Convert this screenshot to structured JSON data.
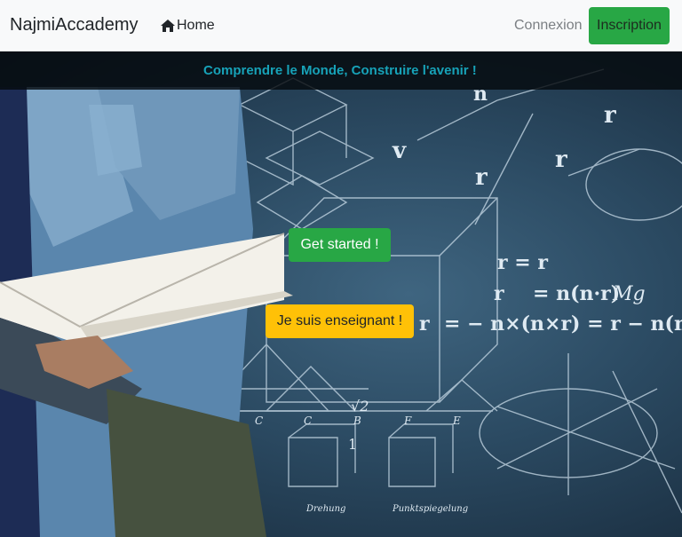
{
  "navbar": {
    "brand": "NajmiAccademy",
    "home_label": "Home",
    "login_label": "Connexion",
    "signup_label": "Inscription"
  },
  "hero": {
    "tagline": "Comprendre le Monde, Construire l'avenir !",
    "get_started_label": "Get started !",
    "teacher_label": "Je suis enseignant !",
    "board_formulas": [
      "r = r∥ + r⊥",
      "r∥ = n(n·r)",
      "r⊥ = − n×(n×r) = r − n(n·r)",
      "Mg",
      "v",
      "r",
      "r∥",
      "r⊥",
      "n",
      "√2",
      "Drehung",
      "Punktspiegelung"
    ]
  },
  "colors": {
    "navbar_bg": "#f8f9fa",
    "success": "#28a745",
    "warning": "#ffc107",
    "info": "#17a2b8",
    "board": "#2b4a62"
  }
}
